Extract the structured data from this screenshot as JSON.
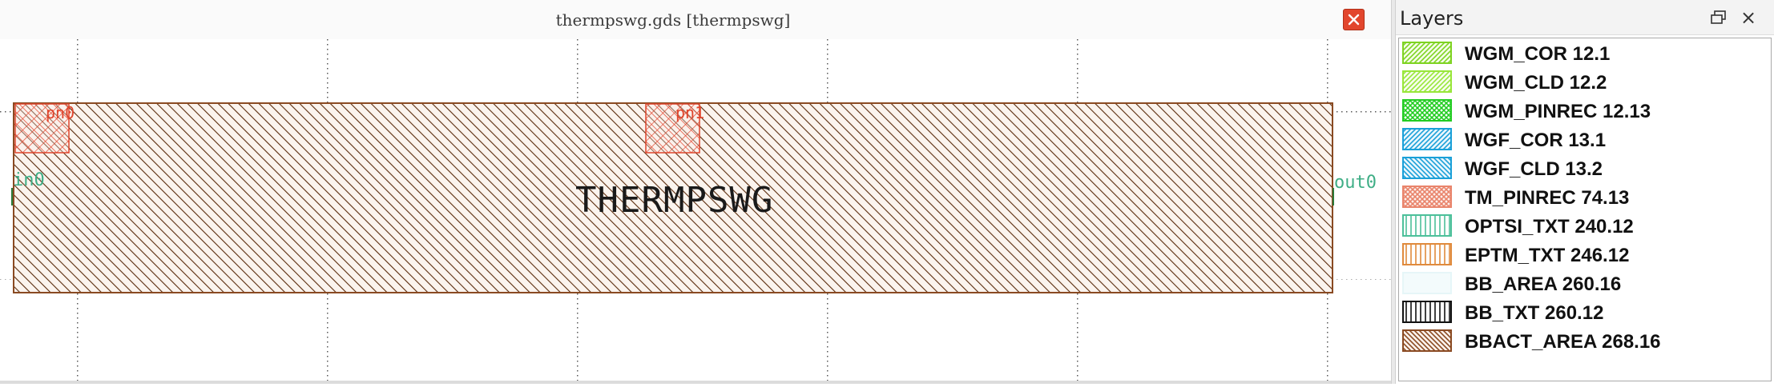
{
  "window": {
    "title": "thermpswg.gds [thermpswg]"
  },
  "canvas": {
    "component_label": "THERMPSWG",
    "port_labels": {
      "top_left": "pn0",
      "top_middle": "pn1",
      "left": "in0",
      "right": "out0"
    }
  },
  "layers_panel": {
    "title": "Layers",
    "items": [
      {
        "label": "WGM_COR 12.1",
        "color": "#7ed321",
        "fill": "#f4fde8",
        "pattern": "diag-fwd"
      },
      {
        "label": "WGM_CLD 12.2",
        "color": "#98e63a",
        "fill": "#f6fdee",
        "pattern": "diag-fwd"
      },
      {
        "label": "WGM_PINREC 12.13",
        "color": "#22cc22",
        "fill": "#ffffff",
        "pattern": "cross"
      },
      {
        "label": "WGF_COR 13.1",
        "color": "#1aa0d8",
        "fill": "#eaf6fc",
        "pattern": "diag-fwd"
      },
      {
        "label": "WGF_CLD 13.2",
        "color": "#1aa0d8",
        "fill": "#eaf6fc",
        "pattern": "diag-back"
      },
      {
        "label": "TM_PINREC 74.13",
        "color": "#e9846b",
        "fill": "#fcefeb",
        "pattern": "cross"
      },
      {
        "label": "OPTSI_TXT 240.12",
        "color": "#4cc09a",
        "fill": "#ffffff",
        "pattern": "vertical"
      },
      {
        "label": "EPTM_TXT 246.12",
        "color": "#e08a3c",
        "fill": "#ffffff",
        "pattern": "vertical"
      },
      {
        "label": "BB_AREA 260.16",
        "color": "#eefafa",
        "fill": "#f3fbfc",
        "pattern": "none"
      },
      {
        "label": "BB_TXT 260.12",
        "color": "#111111",
        "fill": "#ffffff",
        "pattern": "vertical"
      },
      {
        "label": "BBACT_AREA 268.16",
        "color": "#8a4a22",
        "fill": "#fbf2ec",
        "pattern": "diag-back"
      }
    ]
  }
}
